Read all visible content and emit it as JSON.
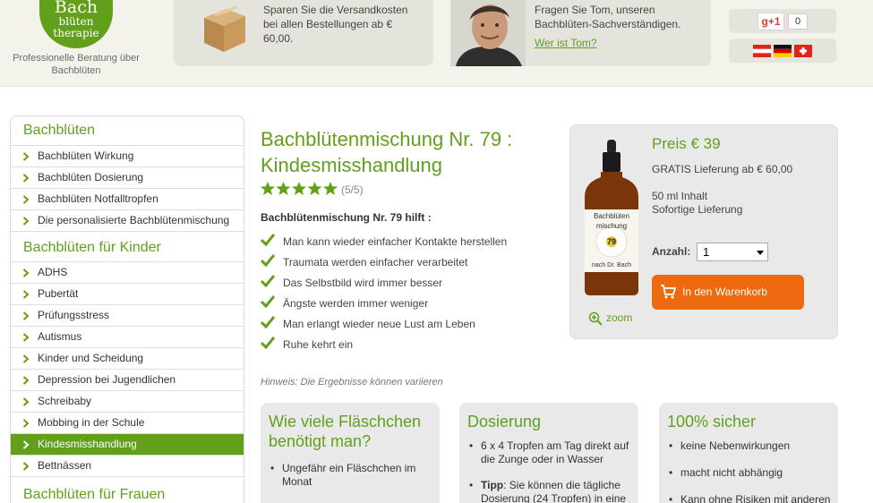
{
  "header": {
    "logo": {
      "line1": "Bach",
      "line2": "blüten",
      "line3": "therapie"
    },
    "tagline": "Professionelle Beratung über Bachblüten",
    "shipping_text": "Sparen Sie die Versandkosten bei allen Bestellungen ab € 60,00.",
    "tom_text": "Fragen Sie Tom, unseren Bachblüten-Sachverständigen.",
    "tom_link": "Wer ist Tom?",
    "gplus_label": "+1",
    "gplus_count": "0",
    "flags": [
      "austria-flag",
      "germany-flag",
      "switzerland-flag"
    ]
  },
  "sidebar": {
    "sections": [
      {
        "title": "Bachblüten",
        "items": [
          {
            "label": "Bachblüten Wirkung"
          },
          {
            "label": "Bachblüten Dosierung"
          },
          {
            "label": "Bachblüten Notfalltropfen"
          },
          {
            "label": "Die personalisierte Bachblütenmischung"
          }
        ]
      },
      {
        "title": "Bachblüten für Kinder",
        "items": [
          {
            "label": "ADHS"
          },
          {
            "label": "Pubertät"
          },
          {
            "label": "Prüfungsstress"
          },
          {
            "label": "Autismus"
          },
          {
            "label": "Kinder und Scheidung"
          },
          {
            "label": "Depression bei Jugendlichen"
          },
          {
            "label": "Schreibaby"
          },
          {
            "label": "Mobbing in der Schule"
          },
          {
            "label": "Kindesmisshandlung",
            "active": true
          },
          {
            "label": "Bettnässen"
          }
        ]
      },
      {
        "title": "Bachblüten für Frauen"
      }
    ]
  },
  "product": {
    "title": "Bachblütenmischung Nr. 79 : Kindesmisshandlung",
    "rating": 5,
    "rating_text": "(5/5)",
    "helps_title": "Bachblütenmischung Nr. 79 hilft :",
    "benefits": [
      "Man kann wieder einfacher Kontakte herstellen",
      "Traumata werden einfacher verarbeitet",
      "Das Selbstbild wird immer besser",
      "Ängste werden immer weniger",
      "Man erlangt wieder neue Lust am Leben",
      "Ruhe kehrt ein"
    ],
    "note": "Hinweis: Die Ergebnisse können variieren"
  },
  "pricebox": {
    "price": "Preis € 39",
    "free_shipping": "GRATIS Lieferung ab € 60,00",
    "content": "50 ml Inhalt",
    "delivery": "Sofortige Lieferung",
    "qty_label": "Anzahl:",
    "qty_value": "1",
    "cart_button": "In den Warenkorb",
    "zoom_label": "zoom",
    "bottle_label": {
      "line1": "Bachblüten",
      "line2": "mischung",
      "number": "79",
      "line3": "nach Dr. Bach"
    }
  },
  "info_boxes": {
    "box1": {
      "title": "Wie viele Fläschchen benötigt man?",
      "items": [
        "Ungefähr ein Fläschchen im Monat"
      ]
    },
    "box2": {
      "title": "Dosierung",
      "item1": "6 x 4 Tropfen am Tag direkt auf die Zunge oder in Wasser",
      "tipp_label": "Tipp",
      "tipp_text": ": Sie können die tägliche Dosierung (24 Tropfen) in eine"
    },
    "box3": {
      "title": "100% sicher",
      "items": [
        "keine Nebenwirkungen",
        "macht nicht abhängig",
        "Kann ohne Risiken mit anderen"
      ]
    }
  },
  "colors": {
    "brand_green": "#62a01c",
    "cart_orange": "#ee6a0f",
    "panel_gray": "#e9e9e9"
  }
}
